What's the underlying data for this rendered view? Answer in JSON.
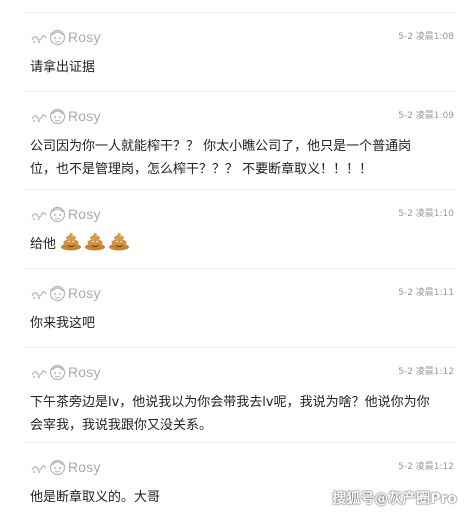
{
  "colors": {
    "background": "#ffffff",
    "divider": "#ececec",
    "username": "#aaaaaa",
    "timestamp": "#9a9a9a",
    "text": "#222222",
    "poop": "#c8832f"
  },
  "comments": [
    {
      "username": "Rosy",
      "time": "5-2 凌晨1:08",
      "text": "请拿出证据"
    },
    {
      "username": "Rosy",
      "time": "5-2 凌晨1:09",
      "text": "公司因为你一人就能榨干？？ 你太小瞧公司了，他只是一个普通岗位，也不是管理岗，怎么榨干？？？ 不要断章取义！！！！"
    },
    {
      "username": "Rosy",
      "time": "5-2 凌晨1:10",
      "text": "给他",
      "emoji": [
        "poop-emoji",
        "poop-emoji",
        "poop-emoji"
      ]
    },
    {
      "username": "Rosy",
      "time": "5-2 凌晨1:11",
      "text": "你来我这吧"
    },
    {
      "username": "Rosy",
      "time": "5-2 凌晨1:12",
      "text": "下午茶旁边是lv，他说我以为你会带我去lv呢，我说为啥？他说你为你会宰我，我说我跟你又没关系。"
    },
    {
      "username": "Rosy",
      "time": "5-2 凌晨1:12",
      "text": "他是断章取义的。大哥"
    }
  ],
  "watermark": "搜狐号@灰产圈Pro"
}
